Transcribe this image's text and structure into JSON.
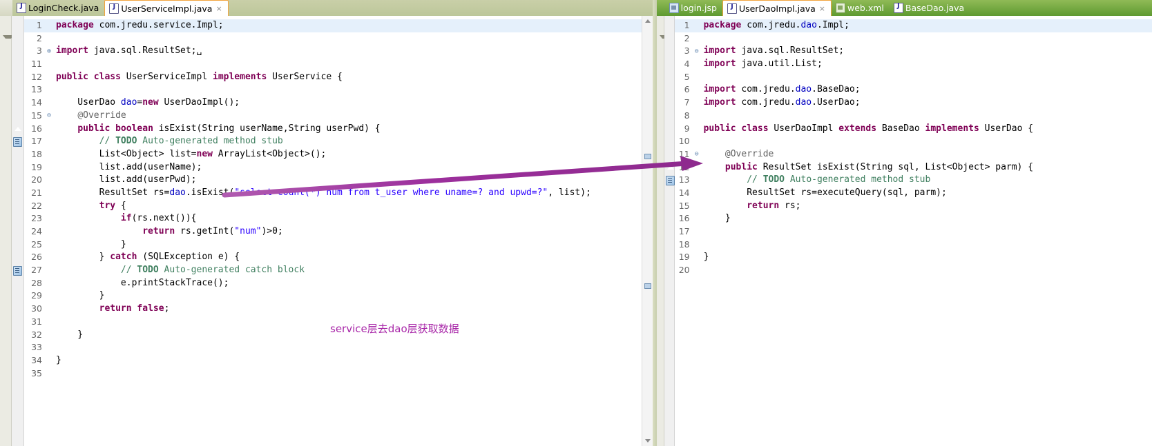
{
  "left_panel": {
    "tabs": [
      {
        "label": "LoginCheck.java",
        "icon": "java-file-icon",
        "active": false,
        "closable": false
      },
      {
        "label": "UserServiceImpl.java",
        "icon": "java-file-icon",
        "active": true,
        "closable": true,
        "close_glyph": "×"
      }
    ],
    "file": "UserServiceImpl.java",
    "lines": [
      {
        "num": "1",
        "fold": "",
        "current": true,
        "marker": "",
        "code": "package com.jredu.service.Impl;"
      },
      {
        "num": "2",
        "fold": "",
        "current": false,
        "marker": "",
        "code": ""
      },
      {
        "num": "3",
        "fold": "⊕",
        "current": false,
        "marker": "",
        "code": "import java.sql.ResultSet;␣"
      },
      {
        "num": "11",
        "fold": "",
        "current": false,
        "marker": "",
        "code": ""
      },
      {
        "num": "12",
        "fold": "",
        "current": false,
        "marker": "",
        "code": "public class UserServiceImpl implements UserService {"
      },
      {
        "num": "13",
        "fold": "",
        "current": false,
        "marker": "",
        "code": ""
      },
      {
        "num": "14",
        "fold": "",
        "current": false,
        "marker": "",
        "code": "    UserDao dao=new UserDaoImpl();"
      },
      {
        "num": "15",
        "fold": "⊖",
        "current": false,
        "marker": "",
        "code": "    @Override"
      },
      {
        "num": "16",
        "fold": "",
        "current": false,
        "marker": "override",
        "code": "    public boolean isExist(String userName,String userPwd) {"
      },
      {
        "num": "17",
        "fold": "",
        "current": false,
        "marker": "todo",
        "code": "        // TODO Auto-generated method stub"
      },
      {
        "num": "18",
        "fold": "",
        "current": false,
        "marker": "",
        "code": "        List<Object> list=new ArrayList<Object>();"
      },
      {
        "num": "19",
        "fold": "",
        "current": false,
        "marker": "",
        "code": "        list.add(userName);"
      },
      {
        "num": "20",
        "fold": "",
        "current": false,
        "marker": "",
        "code": "        list.add(userPwd);"
      },
      {
        "num": "21",
        "fold": "",
        "current": false,
        "marker": "",
        "code": "        ResultSet rs=dao.isExist(\"select count(*) num from t_user where uname=? and upwd=?\", list);"
      },
      {
        "num": "22",
        "fold": "",
        "current": false,
        "marker": "",
        "code": "        try {"
      },
      {
        "num": "23",
        "fold": "",
        "current": false,
        "marker": "",
        "code": "            if(rs.next()){"
      },
      {
        "num": "24",
        "fold": "",
        "current": false,
        "marker": "",
        "code": "                return rs.getInt(\"num\")>0;"
      },
      {
        "num": "25",
        "fold": "",
        "current": false,
        "marker": "",
        "code": "            }"
      },
      {
        "num": "26",
        "fold": "",
        "current": false,
        "marker": "",
        "code": "        } catch (SQLException e) {"
      },
      {
        "num": "27",
        "fold": "",
        "current": false,
        "marker": "todo",
        "code": "            // TODO Auto-generated catch block"
      },
      {
        "num": "28",
        "fold": "",
        "current": false,
        "marker": "",
        "code": "            e.printStackTrace();"
      },
      {
        "num": "29",
        "fold": "",
        "current": false,
        "marker": "",
        "code": "        }"
      },
      {
        "num": "30",
        "fold": "",
        "current": false,
        "marker": "",
        "code": "        return false;"
      },
      {
        "num": "31",
        "fold": "",
        "current": false,
        "marker": "",
        "code": ""
      },
      {
        "num": "32",
        "fold": "",
        "current": false,
        "marker": "",
        "code": "    }"
      },
      {
        "num": "33",
        "fold": "",
        "current": false,
        "marker": "",
        "code": ""
      },
      {
        "num": "34",
        "fold": "",
        "current": false,
        "marker": "",
        "code": "}"
      },
      {
        "num": "35",
        "fold": "",
        "current": false,
        "marker": "",
        "code": ""
      }
    ]
  },
  "right_panel": {
    "tabs": [
      {
        "label": "login.jsp",
        "icon": "jsp-file-icon",
        "active": false,
        "closable": false
      },
      {
        "label": "UserDaoImpl.java",
        "icon": "java-file-icon",
        "active": true,
        "closable": true,
        "close_glyph": "×"
      },
      {
        "label": "web.xml",
        "icon": "xml-file-icon",
        "active": false,
        "closable": false
      },
      {
        "label": "BaseDao.java",
        "icon": "java-file-icon",
        "active": false,
        "closable": false
      }
    ],
    "file": "UserDaoImpl.java",
    "lines": [
      {
        "num": "1",
        "fold": "",
        "current": true,
        "marker": "",
        "code": "package com.jredu.dao.Impl;"
      },
      {
        "num": "2",
        "fold": "",
        "current": false,
        "marker": "",
        "code": ""
      },
      {
        "num": "3",
        "fold": "⊖",
        "current": false,
        "marker": "",
        "code": "import java.sql.ResultSet;"
      },
      {
        "num": "4",
        "fold": "",
        "current": false,
        "marker": "",
        "code": "import java.util.List;"
      },
      {
        "num": "5",
        "fold": "",
        "current": false,
        "marker": "",
        "code": ""
      },
      {
        "num": "6",
        "fold": "",
        "current": false,
        "marker": "",
        "code": "import com.jredu.dao.BaseDao;"
      },
      {
        "num": "7",
        "fold": "",
        "current": false,
        "marker": "",
        "code": "import com.jredu.dao.UserDao;"
      },
      {
        "num": "8",
        "fold": "",
        "current": false,
        "marker": "",
        "code": ""
      },
      {
        "num": "9",
        "fold": "",
        "current": false,
        "marker": "",
        "code": "public class UserDaoImpl extends BaseDao implements UserDao {"
      },
      {
        "num": "10",
        "fold": "",
        "current": false,
        "marker": "",
        "code": ""
      },
      {
        "num": "11",
        "fold": "⊖",
        "current": false,
        "marker": "",
        "code": "    @Override"
      },
      {
        "num": "12",
        "fold": "",
        "current": false,
        "marker": "override",
        "code": "    public ResultSet isExist(String sql, List<Object> parm) {"
      },
      {
        "num": "13",
        "fold": "",
        "current": false,
        "marker": "todo",
        "code": "        // TODO Auto-generated method stub"
      },
      {
        "num": "14",
        "fold": "",
        "current": false,
        "marker": "",
        "code": "        ResultSet rs=executeQuery(sql, parm);"
      },
      {
        "num": "15",
        "fold": "",
        "current": false,
        "marker": "",
        "code": "        return rs;"
      },
      {
        "num": "16",
        "fold": "",
        "current": false,
        "marker": "",
        "code": "    }"
      },
      {
        "num": "17",
        "fold": "",
        "current": false,
        "marker": "",
        "code": ""
      },
      {
        "num": "18",
        "fold": "",
        "current": false,
        "marker": "",
        "code": ""
      },
      {
        "num": "19",
        "fold": "",
        "current": false,
        "marker": "",
        "code": "}"
      },
      {
        "num": "20",
        "fold": "",
        "current": false,
        "marker": "",
        "code": ""
      }
    ]
  },
  "annotation": {
    "note_text": "service层去dao层获取数据",
    "note_color": "#a826a8",
    "arrow_color": "#8e2a8e",
    "arrow_from": "left line 20-21",
    "arrow_to": "right line 12"
  },
  "colors": {
    "tab_bar_active_green": "#6fa13a",
    "tab_active_border": "#f2a33c",
    "current_line_highlight": "#e5f0fb",
    "keyword": "#7f0055",
    "string": "#2a00ff",
    "comment": "#3f7f5f",
    "annotation_gray": "#646464",
    "field_blue": "#0000c0"
  }
}
